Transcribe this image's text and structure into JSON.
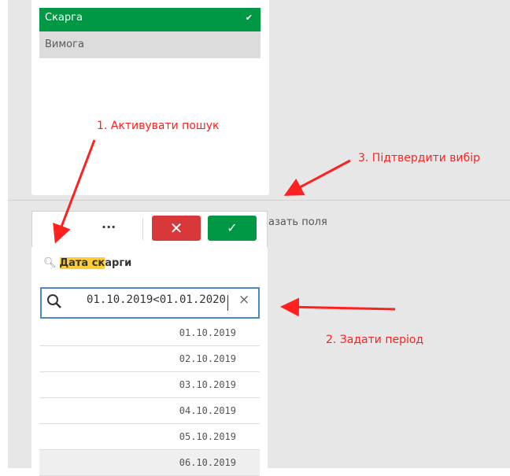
{
  "dropdown": {
    "options": [
      {
        "label": "Скарга",
        "selected": true
      },
      {
        "label": "Вимога",
        "selected": false
      }
    ]
  },
  "toolbar": {
    "more_label": "···",
    "cancel_label": "✕",
    "confirm_label": "✓"
  },
  "show_fields_label": "азать поля",
  "field": {
    "title_highlight": "Дата ск",
    "title_rest": "арги"
  },
  "search": {
    "value": "01.10.2019<01.01.2020",
    "clear_label": "×"
  },
  "dates": [
    "01.10.2019",
    "02.10.2019",
    "03.10.2019",
    "04.10.2019",
    "05.10.2019",
    "06.10.2019"
  ],
  "annotations": {
    "step1": "1. Активувати пошук",
    "step2": "2. Задати період",
    "step3": "3. Підтвердити вибір"
  },
  "colors": {
    "selected_green": "#009845",
    "cancel_red": "#d9383a",
    "highlight": "#ffcc33",
    "annotation_red": "#ff2020",
    "focus_border": "#4e88c2"
  }
}
